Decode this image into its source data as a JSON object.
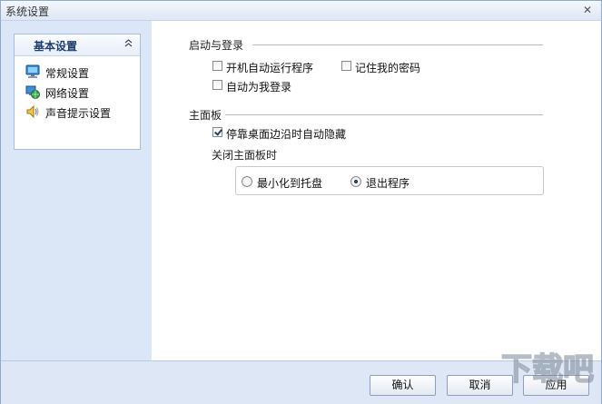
{
  "window": {
    "title": "系统设置"
  },
  "sidebar": {
    "header": "基本设置",
    "items": [
      {
        "label": "常规设置",
        "icon": "monitor-icon"
      },
      {
        "label": "网络设置",
        "icon": "network-globe-icon"
      },
      {
        "label": "声音提示设置",
        "icon": "speaker-icon"
      }
    ]
  },
  "startup": {
    "title": "启动与登录",
    "auto_run": {
      "label": "开机自动运行程序",
      "checked": false
    },
    "remember_password": {
      "label": "记住我的密码",
      "checked": false
    },
    "auto_login": {
      "label": "自动为我登录",
      "checked": false
    }
  },
  "mainpanel": {
    "title": "主面板",
    "auto_hide": {
      "label": "停靠桌面边沿时自动隐藏",
      "checked": true
    },
    "close_label": "关闭主面板时",
    "options": [
      {
        "label": "最小化到托盘",
        "selected": false
      },
      {
        "label": "退出程序",
        "selected": true
      }
    ]
  },
  "footer": {
    "ok_label": "确认",
    "cancel_label": "取消",
    "apply_label": "应用"
  },
  "watermark": {
    "text": "下载吧"
  },
  "colors": {
    "sidebar_bg": "#dbe6f6",
    "accent": "#1d3d6e",
    "footer_bg": "#dde7f5"
  }
}
